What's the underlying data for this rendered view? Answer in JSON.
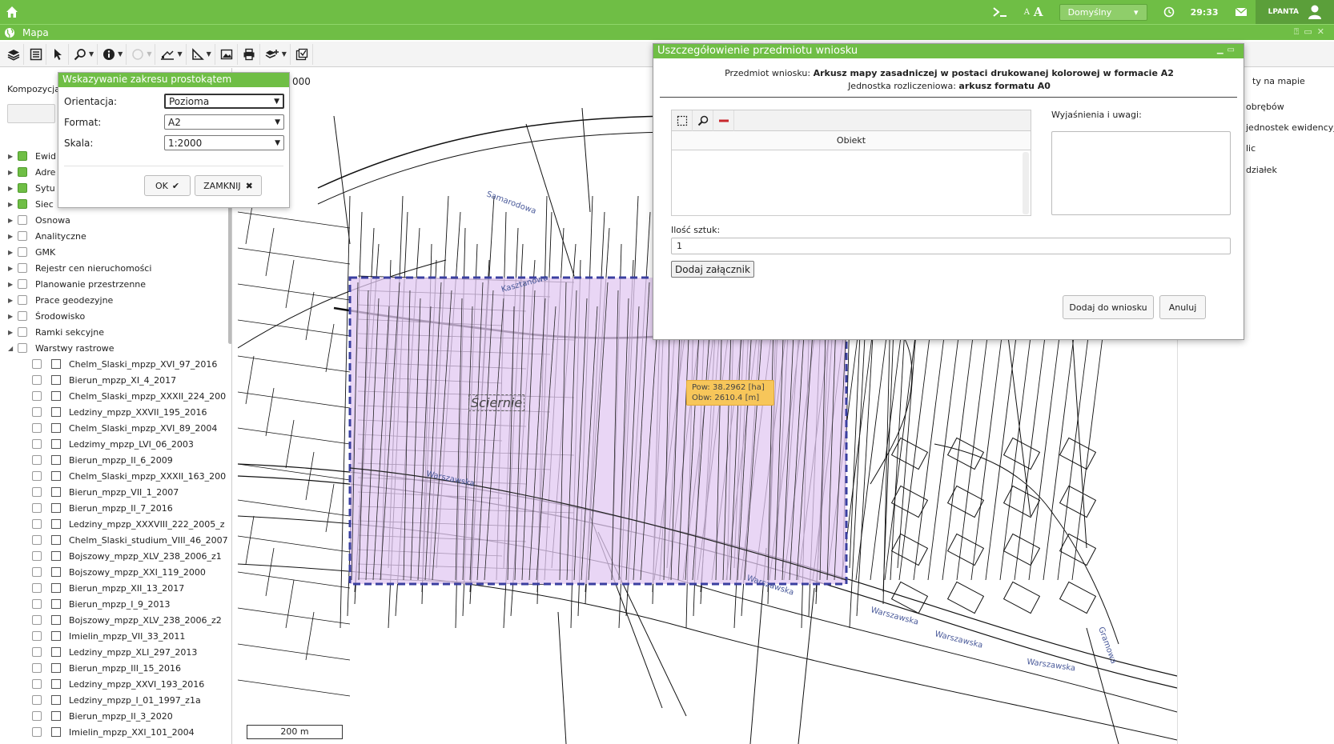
{
  "topbar": {
    "profile": "Domyślny",
    "clock": "29:33",
    "user": "LPANTA",
    "font_small": "A",
    "font_large": "A"
  },
  "window": {
    "title": "Mapa"
  },
  "left_panel": {
    "composition_label": "Kompozycja",
    "tree_top": [
      {
        "label": "Ewid",
        "checked": true
      },
      {
        "label": "Adre",
        "checked": true
      },
      {
        "label": "Sytu",
        "checked": true
      },
      {
        "label": "Siec",
        "checked": true
      },
      {
        "label": "Osnowa",
        "checked": false
      },
      {
        "label": "Analityczne",
        "checked": false
      },
      {
        "label": "GMK",
        "checked": false
      },
      {
        "label": "Rejestr cen nieruchomości",
        "checked": false
      },
      {
        "label": "Planowanie przestrzenne",
        "checked": false
      },
      {
        "label": "Prace geodezyjne",
        "checked": false
      },
      {
        "label": "Środowisko",
        "checked": false
      },
      {
        "label": "Ramki sekcyjne",
        "checked": false
      },
      {
        "label": "Warstwy rastrowe",
        "checked": false
      }
    ],
    "raster_layers": [
      "Chelm_Slaski_mpzp_XVI_97_2016",
      "Bierun_mpzp_XI_4_2017",
      "Chelm_Slaski_mpzp_XXXII_224_200",
      "Ledziny_mpzp_XXVII_195_2016",
      "Chelm_Slaski_mpzp_XVI_89_2004",
      "Ledzimy_mpzp_LVI_06_2003",
      "Bierun_mpzp_II_6_2009",
      "Chelm_Slaski_mpzp_XXXII_163_200",
      "Bierun_mpzp_VII_1_2007",
      "Bierun_mpzp_II_7_2016",
      "Ledziny_mpzp_XXXVIII_222_2005_z",
      "Chelm_Slaski_studium_VIII_46_2007",
      "Bojszowy_mpzp_XLV_238_2006_z1",
      "Bojszowy_mpzp_XXI_119_2000",
      "Bierun_mpzp_XII_13_2017",
      "Bierun_mpzp_I_9_2013",
      "Bojszowy_mpzp_XLV_238_2006_z2",
      "Imielin_mpzp_VII_33_2011",
      "Ledziny_mpzp_XLI_297_2013",
      "Bierun_mpzp_III_15_2016",
      "Ledziny_mpzp_XXVI_193_2016",
      "Ledziny_mpzp_I_01_1997_z1a",
      "Bierun_mpzp_II_3_2020",
      "Imielin_mpzp_XXI_101_2004"
    ]
  },
  "map": {
    "scale_value": "000",
    "scalebar": "200 m",
    "place_label": "Ściernie",
    "tooltip_area": "Pow: 38.2962 [ha]",
    "tooltip_perimeter": "Obw: 2610.4 [m]",
    "streets": [
      "Warszawska",
      "Warszawska",
      "Warszawska",
      "Warszawska",
      "Warszawska",
      "Samarodowa",
      "Kasztanowa",
      "Gramowa"
    ]
  },
  "right_panel": {
    "items": [
      "ty na mapie",
      "obrębów",
      "jednostek ewidencyjny",
      "lic",
      "działek"
    ]
  },
  "rect_popup": {
    "title": "Wskazywanie zakresu prostokątem",
    "orientation_label": "Orientacja:",
    "orientation_value": "Pozioma",
    "format_label": "Format:",
    "format_value": "A2",
    "scale_label": "Skala:",
    "scale_value": "1:2000",
    "ok": "OK",
    "close": "ZAMKNIJ"
  },
  "dialog": {
    "title": "Uszczegółowienie przedmiotu wniosku",
    "subject_label": "Przedmiot wniosku:",
    "subject_value": "Arkusz mapy zasadniczej w postaci drukowanej kolorowej w formacie A2",
    "unit_label": "Jednostka rozliczeniowa:",
    "unit_value": "arkusz formatu A0",
    "object_header": "Obiekt",
    "notes_label": "Wyjaśnienia i uwagi:",
    "qty_label": "Ilość sztuk:",
    "qty_value": "1",
    "attach_btn": "Dodaj załącznik",
    "add_btn": "Dodaj do wniosku",
    "cancel_btn": "Anuluj"
  },
  "colors": {
    "accent": "#6fbe45",
    "selection": "#e1c8f2",
    "selection_border": "#3a3fa0",
    "tooltip": "#f7c65a"
  }
}
